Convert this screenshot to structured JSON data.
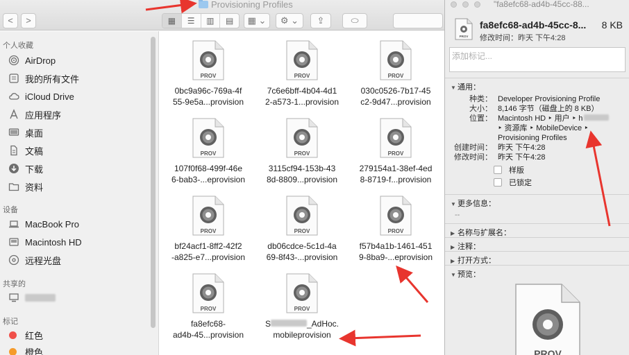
{
  "finder": {
    "title": "Provisioning Profiles",
    "nav": {
      "back": "<",
      "forward": ">"
    },
    "sidebar": {
      "favorites_header": "个人收藏",
      "favorites": [
        {
          "label": "AirDrop",
          "icon": "airdrop-icon"
        },
        {
          "label": "我的所有文件",
          "icon": "all-files-icon"
        },
        {
          "label": "iCloud Drive",
          "icon": "cloud-icon"
        },
        {
          "label": "应用程序",
          "icon": "applications-icon"
        },
        {
          "label": "桌面",
          "icon": "desktop-icon"
        },
        {
          "label": "文稿",
          "icon": "documents-icon"
        },
        {
          "label": "下载",
          "icon": "downloads-icon"
        },
        {
          "label": "资料",
          "icon": "folder-icon"
        }
      ],
      "devices_header": "设备",
      "devices": [
        {
          "label": "MacBook Pro",
          "icon": "laptop-icon"
        },
        {
          "label": "Macintosh HD",
          "icon": "harddisk-icon"
        },
        {
          "label": "远程光盘",
          "icon": "disc-icon"
        }
      ],
      "shared_header": "共享的",
      "tags_header": "标记",
      "tags": [
        {
          "label": "红色",
          "color": "#f0504a"
        },
        {
          "label": "橙色",
          "color": "#f59b2b"
        }
      ]
    },
    "files": [
      {
        "line1": "0bc9a96c-769a-4f",
        "line2": "55-9e5a...provision"
      },
      {
        "line1": "7c6e6bff-4b04-4d1",
        "line2": "2-a573-1...provision"
      },
      {
        "line1": "030c0526-7b17-45",
        "line2": "c2-9d47...provision"
      },
      {
        "line1": "107f0f68-499f-46e",
        "line2": "6-bab3-...eprovision"
      },
      {
        "line1": "3115cf94-153b-43",
        "line2": "8d-8809...provision"
      },
      {
        "line1": "279154a1-38ef-4ed",
        "line2": "8-8719-f...provision"
      },
      {
        "line1": "bf24acf1-8ff2-42f2",
        "line2": "-a825-e7...provision"
      },
      {
        "line1": "db06cdce-5c1d-4a",
        "line2": "69-8f43-...provision"
      },
      {
        "line1": "f57b4a1b-1461-451",
        "line2": "9-8ba9-...eprovision"
      },
      {
        "line1": "fa8efc68-",
        "line2": "ad4b-45...provision"
      },
      {
        "line1": "S",
        "line1b": "_AdHoc.",
        "line2": "mobileprovision"
      }
    ],
    "doc_badge": "PROV"
  },
  "info": {
    "window_title": "\"fa8efc68-ad4b-45cc-88...",
    "file_name": "fa8efc68-ad4b-45cc-8...",
    "file_size": "8 KB",
    "modified_line": "修改时间：昨天 下午4:28",
    "tags_placeholder": "添加标记...",
    "general_title": "通用：",
    "kind_k": "种类：",
    "kind_v": "Developer Provisioning Profile",
    "size_k": "大小：",
    "size_v": "8,146 字节（磁盘上的 8 KB）",
    "where_k": "位置：",
    "where_v1": "Macintosh HD ‣ 用户 ‣ h",
    "where_v2": "‣ 资源库 ‣ MobileDevice ‣",
    "where_v3": "Provisioning Profiles",
    "created_k": "创建时间：",
    "created_v": "昨天 下午4:28",
    "modified_k": "修改时间：",
    "modified_v": "昨天 下午4:28",
    "stationery": "样版",
    "locked": "已锁定",
    "more_info_title": "更多信息：",
    "more_info_value": "--",
    "name_ext_title": "名称与扩展名：",
    "comments_title": "注释：",
    "open_with_title": "打开方式：",
    "preview_title": "预览：",
    "preview_badge": "PROV"
  }
}
